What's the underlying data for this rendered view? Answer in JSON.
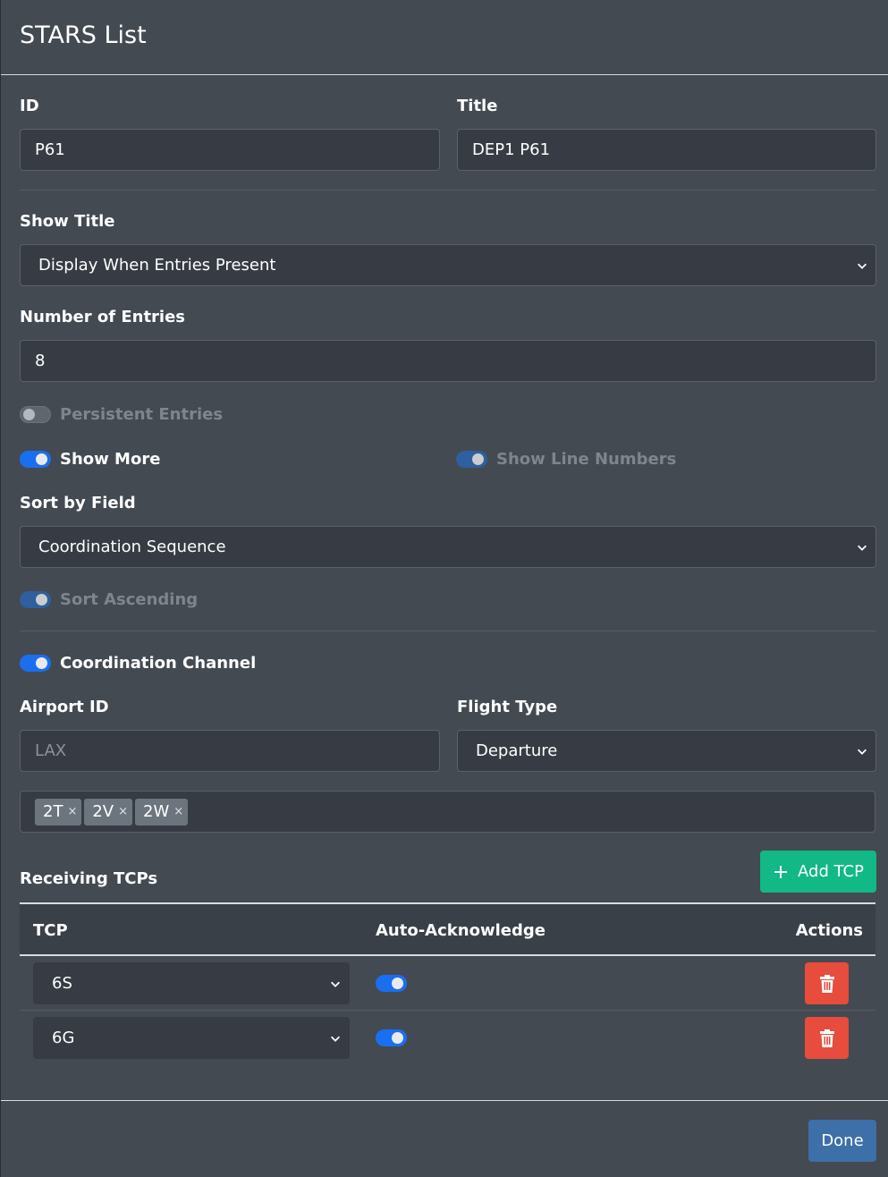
{
  "dialog": {
    "title": "STARS List"
  },
  "form": {
    "id_label": "ID",
    "id_value": "P61",
    "title_label": "Title",
    "title_value": "DEP1 P61",
    "show_title_label": "Show Title",
    "show_title_value": "Display When Entries Present",
    "num_entries_label": "Number of Entries",
    "num_entries_value": "8",
    "persistent_entries": {
      "label": "Persistent Entries",
      "on": false
    },
    "show_more": {
      "label": "Show More",
      "on": true
    },
    "show_line_numbers": {
      "label": "Show Line Numbers",
      "on": true
    },
    "sort_by_label": "Sort by Field",
    "sort_by_value": "Coordination Sequence",
    "sort_ascending": {
      "label": "Sort Ascending",
      "on": true
    },
    "coordination_channel": {
      "label": "Coordination Channel",
      "on": true
    },
    "airport_id_label": "Airport ID",
    "airport_id_placeholder": "LAX",
    "flight_type_label": "Flight Type",
    "flight_type_value": "Departure",
    "tags": [
      "2T",
      "2V",
      "2W"
    ],
    "tag_remove": "×"
  },
  "tcps": {
    "title": "Receiving TCPs",
    "add_label": "Add TCP",
    "columns": [
      "TCP",
      "Auto-Acknowledge",
      "Actions"
    ],
    "rows": [
      {
        "tcp": "6S",
        "auto_ack": true
      },
      {
        "tcp": "6G",
        "auto_ack": true
      }
    ]
  },
  "footer": {
    "done_label": "Done"
  },
  "colors": {
    "background": "#434a52",
    "switch_on": "#1a6ff0",
    "add_button": "#12b886",
    "delete_button": "#e74c3c",
    "done_button": "#3d6fa8"
  }
}
